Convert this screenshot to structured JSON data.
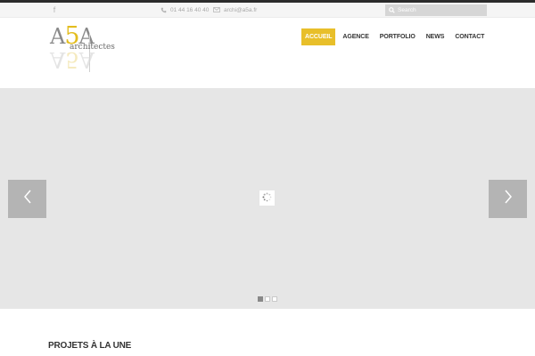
{
  "topbar": {
    "social": {
      "facebook_icon": "facebook-icon"
    },
    "phone": "01 44 16 40 40",
    "email": "archi@a5a.fr",
    "search": {
      "placeholder": "Search",
      "value": ""
    }
  },
  "logo": {
    "mark_left": "A",
    "mark_middle": "5",
    "mark_right": "A",
    "text": "architectes",
    "colors": {
      "grey": "#8a8a8a",
      "gold": "#e3bd1f"
    }
  },
  "nav": {
    "items": [
      {
        "label": "ACCUEIL",
        "active": true
      },
      {
        "label": "AGENCE",
        "active": false
      },
      {
        "label": "PORTFOLIO",
        "active": false
      },
      {
        "label": "NEWS",
        "active": false
      },
      {
        "label": "CONTACT",
        "active": false
      }
    ]
  },
  "slider": {
    "prev_icon": "chevron-left-icon",
    "next_icon": "chevron-right-icon",
    "loading_icon": "spinner-icon",
    "slides_count": 3,
    "active_slide": 1
  },
  "sections": {
    "featured_title": "PROJETS À LA UNE"
  },
  "colors": {
    "accent": "#e8bf2a",
    "slider_bg": "#e6e6e6",
    "arrow_bg": "#b4b4b4"
  }
}
